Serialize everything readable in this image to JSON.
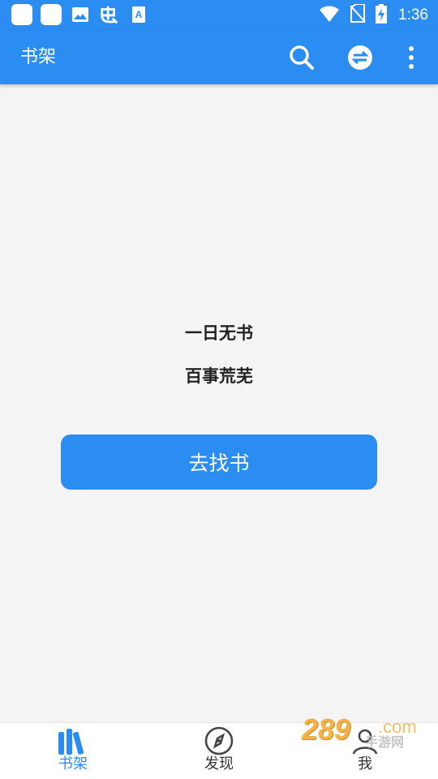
{
  "status_bar": {
    "time": "1:36",
    "left_icons": [
      "notification-square-icon",
      "notification-square-icon",
      "image-icon",
      "app-logo-icon",
      "text-a-icon"
    ],
    "right_icons": [
      "wifi-icon",
      "no-sim-icon",
      "battery-charging-icon"
    ]
  },
  "toolbar": {
    "title": "书架",
    "actions": [
      "search-icon",
      "swap-icon",
      "more-vert-icon"
    ]
  },
  "empty_state": {
    "line1": "一日无书",
    "line2": "百事荒芜",
    "button_label": "去找书"
  },
  "bottom_nav": {
    "items": [
      {
        "label": "书架",
        "icon": "bookshelf-icon",
        "active": true
      },
      {
        "label": "发现",
        "icon": "compass-icon",
        "active": false
      },
      {
        "label": "我",
        "icon": "person-icon",
        "active": false
      }
    ]
  },
  "watermark": {
    "number": "289",
    "domain": ".com",
    "text": "手游网"
  },
  "colors": {
    "primary": "#2b8cf2",
    "background": "#f4f4f4",
    "text_dark": "#222222"
  }
}
